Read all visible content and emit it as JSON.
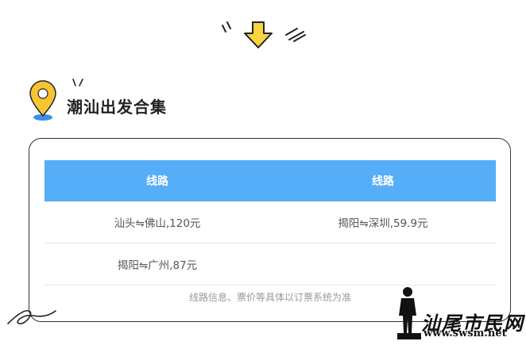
{
  "header": {
    "title": "潮汕出发合集"
  },
  "table": {
    "columns": [
      "线路",
      "线路"
    ],
    "rows": [
      [
        "汕头⇋佛山,120元",
        "揭阳⇋深圳,59.9元"
      ],
      [
        "揭阳⇋广州,87元",
        ""
      ]
    ]
  },
  "footer": {
    "note": "线路信息、票价等具体以订票系统为准"
  },
  "watermark": {
    "brand": "汕尾市民网",
    "url": "www.swsm.net"
  },
  "icons": [
    "down-arrow-icon",
    "location-pin-icon"
  ],
  "colors": {
    "header_bg": "#55aef7",
    "pin_yellow": "#f7c531",
    "pin_blue": "#3b8fe6",
    "arrow_yellow": "#f9d342"
  }
}
